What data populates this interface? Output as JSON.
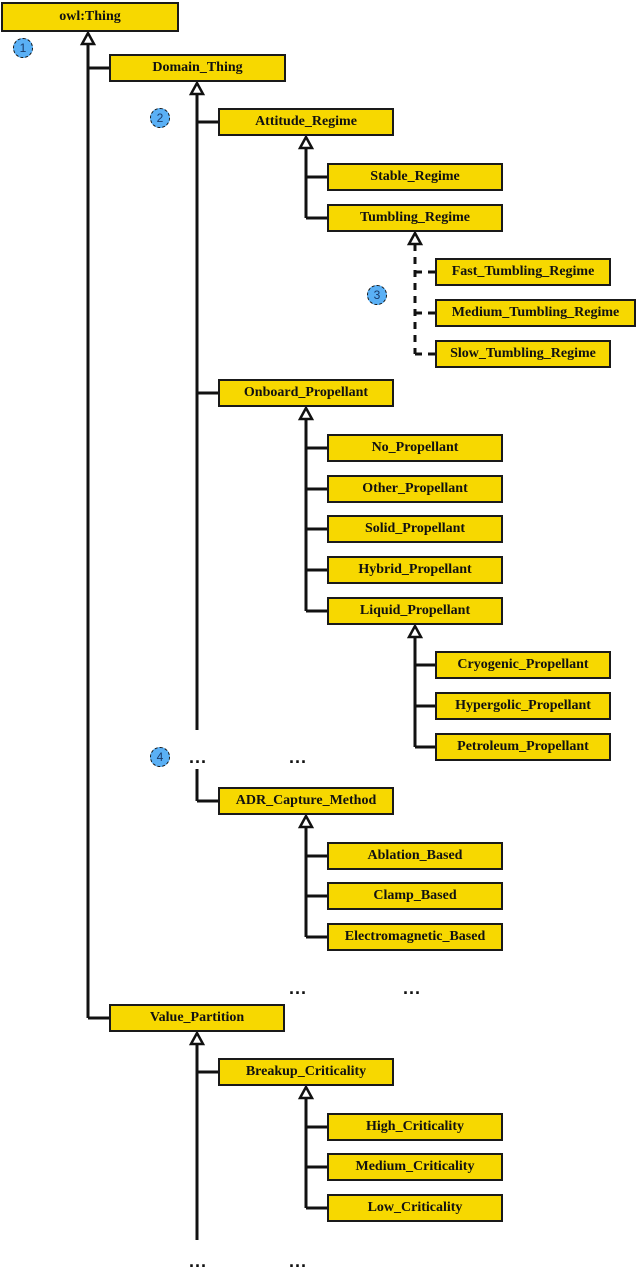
{
  "diagram": {
    "type": "class-hierarchy",
    "fill_color": "#f7d800",
    "badge_color": "#5ab0f5",
    "nodes": [
      {
        "id": "owl_thing",
        "label": "owl:Thing"
      },
      {
        "id": "domain_thing",
        "label": "Domain_Thing",
        "parent": "owl_thing"
      },
      {
        "id": "attitude_regime",
        "label": "Attitude_Regime",
        "parent": "domain_thing"
      },
      {
        "id": "stable_regime",
        "label": "Stable_Regime",
        "parent": "attitude_regime"
      },
      {
        "id": "tumbling_regime",
        "label": "Tumbling_Regime",
        "parent": "attitude_regime"
      },
      {
        "id": "fast_tumbling_regime",
        "label": "Fast_Tumbling_Regime",
        "parent": "tumbling_regime",
        "edge": "dashed"
      },
      {
        "id": "medium_tumbling_regime",
        "label": "Medium_Tumbling_Regime",
        "parent": "tumbling_regime",
        "edge": "dashed"
      },
      {
        "id": "slow_tumbling_regime",
        "label": "Slow_Tumbling_Regime",
        "parent": "tumbling_regime",
        "edge": "dashed"
      },
      {
        "id": "onboard_propellant",
        "label": "Onboard_Propellant",
        "parent": "domain_thing"
      },
      {
        "id": "no_propellant",
        "label": "No_Propellant",
        "parent": "onboard_propellant"
      },
      {
        "id": "other_propellant",
        "label": "Other_Propellant",
        "parent": "onboard_propellant"
      },
      {
        "id": "solid_propellant",
        "label": "Solid_Propellant",
        "parent": "onboard_propellant"
      },
      {
        "id": "hybrid_propellant",
        "label": "Hybrid_Propellant",
        "parent": "onboard_propellant"
      },
      {
        "id": "liquid_propellant",
        "label": "Liquid_Propellant",
        "parent": "onboard_propellant"
      },
      {
        "id": "cryogenic_propellant",
        "label": "Cryogenic_Propellant",
        "parent": "liquid_propellant"
      },
      {
        "id": "hypergolic_propellant",
        "label": "Hypergolic_Propellant",
        "parent": "liquid_propellant"
      },
      {
        "id": "petroleum_propellant",
        "label": "Petroleum_Propellant",
        "parent": "liquid_propellant"
      },
      {
        "id": "adr_capture_method",
        "label": "ADR_Capture_Method",
        "parent": "domain_thing"
      },
      {
        "id": "ablation_based",
        "label": "Ablation_Based",
        "parent": "adr_capture_method"
      },
      {
        "id": "clamp_based",
        "label": "Clamp_Based",
        "parent": "adr_capture_method"
      },
      {
        "id": "electromagnetic_based",
        "label": "Electromagnetic_Based",
        "parent": "adr_capture_method"
      },
      {
        "id": "value_partition",
        "label": "Value_Partition",
        "parent": "owl_thing"
      },
      {
        "id": "breakup_criticality",
        "label": "Breakup_Criticality",
        "parent": "value_partition"
      },
      {
        "id": "high_criticality",
        "label": "High_Criticality",
        "parent": "breakup_criticality"
      },
      {
        "id": "medium_criticality",
        "label": "Medium_Criticality",
        "parent": "breakup_criticality"
      },
      {
        "id": "low_criticality",
        "label": "Low_Criticality",
        "parent": "breakup_criticality"
      }
    ],
    "badges": [
      "1",
      "2",
      "3",
      "4"
    ],
    "ellipsis": "..."
  }
}
